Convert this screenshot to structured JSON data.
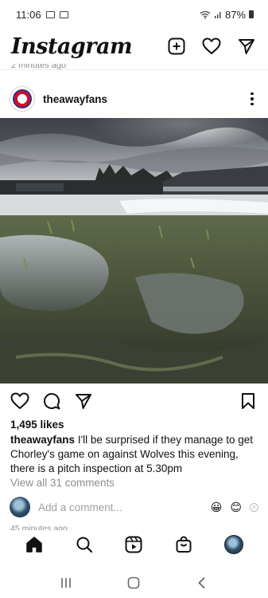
{
  "status_bar": {
    "time": "11:06",
    "battery": "87%"
  },
  "header": {
    "brand": "Instagram"
  },
  "feed": {
    "prev_post_time": "2 minutes ago"
  },
  "post": {
    "username": "theawayfans",
    "likes": "1,495 likes",
    "caption_username": "theawayfans",
    "caption_text": "I'll be surprised if they manage to get Chorley's game on against Wolves this evening, there is a pitch inspection at 5.30pm",
    "view_comments": "View all 31 comments",
    "comment_placeholder": "Add a comment...",
    "posted_time": "45 minutes ago",
    "emojis": [
      "😀",
      "😊"
    ]
  },
  "icons": {
    "header": [
      "new-post-icon",
      "heart-icon",
      "direct-message-icon"
    ],
    "actions": [
      "like-icon",
      "comment-icon",
      "share-icon",
      "save-icon"
    ],
    "tabs": [
      "home-icon",
      "search-icon",
      "reels-icon",
      "shop-icon",
      "profile-avatar"
    ],
    "nav": [
      "recents-icon",
      "home-nav-icon",
      "back-icon"
    ]
  }
}
